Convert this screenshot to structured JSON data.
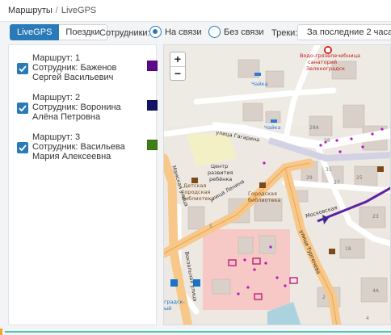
{
  "breadcrumb": {
    "root": "Маршруты",
    "separator": "/",
    "current": "LiveGPS"
  },
  "tabs": [
    {
      "label": "LiveGPS",
      "active": true
    },
    {
      "label": "Поездки",
      "active": false
    }
  ],
  "filters": {
    "employees_label": "Сотрудники:",
    "status_options": [
      {
        "label": "На связи",
        "selected": true
      },
      {
        "label": "Без связи",
        "selected": false
      }
    ],
    "tracks_label": "Треки:",
    "tracks_value": "За последние 2 часа"
  },
  "routes": [
    {
      "route_label": "Маршрут: 1",
      "employee_label": "Сотрудник: Баженов",
      "employee_name": "Сергей Васильевич",
      "checked": true,
      "color": "#5c0a8a"
    },
    {
      "route_label": "Маршрут: 2",
      "employee_label": "Сотрудник: Воронина",
      "employee_name": "Алёна Петровна",
      "checked": true,
      "color": "#141466"
    },
    {
      "route_label": "Маршрут: 3",
      "employee_label": "Сотрудник: Васильева",
      "employee_name": "Мария Алексеевна",
      "checked": true,
      "color": "#3f7f18"
    }
  ],
  "map": {
    "zoom_in": "+",
    "zoom_out": "−",
    "labels": {
      "sanatorium_1": "Водо-грязелечебница",
      "sanatorium_2": "санаторий",
      "sanatorium_3": "Зеленоградск",
      "chayka_1": "Чайка",
      "chayka_2": "Чайка",
      "street_gagarina": "улица Гагарина",
      "center_1": "Центр",
      "center_2": "развития",
      "center_3": "ребёнка",
      "street_lenina": "улица Ленина",
      "kids_lib_1": "Детская",
      "kids_lib_2": "городская",
      "kids_lib_3": "библиотека",
      "city_lib_1": "Городская",
      "city_lib_2": "библиотека",
      "street_turgeneva": "улица Тургенева",
      "street_vokzalnaya": "Вокзальная улица",
      "street_moskovskaya": "Московская",
      "street_left": "Мамская улица",
      "station_1": "градск-",
      "station_2": "ый",
      "num_28a": "28А",
      "num_28": "28",
      "num_31": "31",
      "num_29": "29",
      "num_27": "27",
      "num_25": "25",
      "num_23": "23",
      "num_18": "18",
      "num_5": "5",
      "num_2": "2",
      "num_4a": "4А",
      "num_4": "4"
    }
  }
}
